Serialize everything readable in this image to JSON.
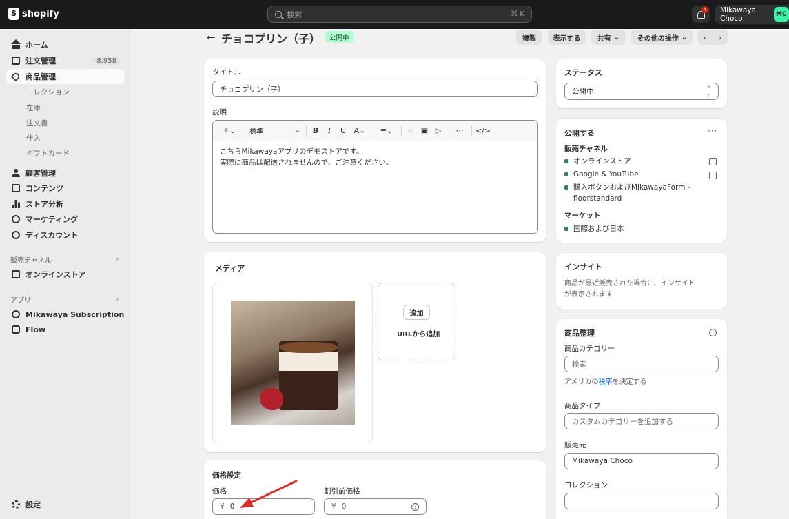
{
  "topbar": {
    "brand": "shopify",
    "search_placeholder": "検索",
    "shortcut": "⌘ K",
    "notification_count": "4",
    "store_name": "Mikawaya Choco",
    "avatar_initials": "MC"
  },
  "sidebar": {
    "items": [
      {
        "label": "ホーム",
        "icon": "home-icon"
      },
      {
        "label": "注文管理",
        "icon": "inbox-icon",
        "count": "8,958"
      },
      {
        "label": "商品管理",
        "icon": "tag-icon",
        "active": true
      },
      {
        "label": "顧客管理",
        "icon": "person-icon"
      },
      {
        "label": "コンテンツ",
        "icon": "content-icon"
      },
      {
        "label": "ストア分析",
        "icon": "analytics-icon"
      },
      {
        "label": "マーケティング",
        "icon": "target-icon"
      },
      {
        "label": "ディスカウント",
        "icon": "discount-icon"
      }
    ],
    "product_sub": [
      "コレクション",
      "在庫",
      "注文書",
      "仕入",
      "ギフトカード"
    ],
    "sales_channels_label": "販売チャネル",
    "online_store": "オンラインストア",
    "apps_label": "アプリ",
    "apps": [
      "Mikawaya Subscription",
      "Flow"
    ],
    "settings": "設定"
  },
  "header": {
    "title": "チョコプリン（子）",
    "status_badge": "公開中",
    "actions": [
      "複製",
      "表示する",
      "共有",
      "その他の操作"
    ]
  },
  "product": {
    "title_label": "タイトル",
    "title_value": "チョコプリン（子）",
    "description_label": "説明",
    "format_select": "標準",
    "description_lines": [
      "こちらMikawayaアプリのデモストアです。",
      "実際に商品は配送されませんので、ご注意ください。"
    ]
  },
  "media": {
    "title": "メディア",
    "add_button": "追加",
    "add_from_url": "URLから追加"
  },
  "pricing": {
    "title": "価格設定",
    "price_label": "価格",
    "price_value": "0",
    "compare_label": "割引前価格",
    "compare_value": "0",
    "currency": "¥"
  },
  "status": {
    "title": "ステータス",
    "value": "公開中"
  },
  "publishing": {
    "title": "公開する",
    "channels_label": "販売チャネル",
    "channels": [
      "オンラインストア",
      "Google & YouTube",
      "購入ボタンおよびMikawayaForm -",
      "floorstandard"
    ],
    "markets_label": "マーケット",
    "markets": [
      "国際および日本"
    ]
  },
  "insights": {
    "title": "インサイト",
    "text_line1": "商品が最近販売された場合に、インサイト",
    "text_line2": "が表示されます"
  },
  "organization": {
    "title": "商品整理",
    "category_label": "商品カテゴリー",
    "category_placeholder": "検索",
    "tax_prefix": "アメリカの",
    "tax_link": "税率",
    "tax_suffix": "を決定する",
    "type_label": "商品タイプ",
    "type_placeholder": "カスタムカテゴリーを追加する",
    "vendor_label": "販売元",
    "vendor_value": "Mikawaya Choco",
    "collections_label": "コレクション"
  },
  "colors": {
    "topbar": "#1a1a1a",
    "sidebar": "#ebebeb",
    "success": "#29845a",
    "badge_bg": "#b4fed2",
    "annotation_arrow": "#e02b27"
  }
}
